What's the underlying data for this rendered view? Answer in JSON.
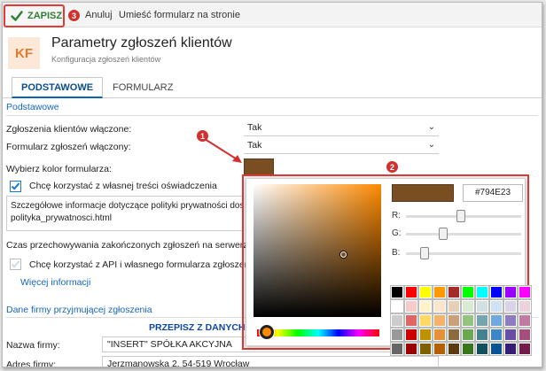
{
  "toolbar": {
    "save_label": "ZAPISZ",
    "cancel_label": "Anuluj",
    "embed_label": "Umieść formularz na stronie"
  },
  "badges": {
    "b1": "1",
    "b2": "2",
    "b3": "3"
  },
  "header": {
    "logo_text": "KF",
    "title": "Parametry zgłoszeń klientów",
    "subtitle": "Konfiguracja zgłoszeń klientów"
  },
  "tabs": [
    {
      "label": "PODSTAWOWE"
    },
    {
      "label": "FORMULARZ"
    }
  ],
  "basic": {
    "section_title": "Podstawowe",
    "requests_enabled_label": "Zgłoszenia klientów włączone:",
    "requests_enabled_value": "Tak",
    "form_enabled_label": "Formularz zgłoszeń włączony:",
    "form_enabled_value": "Tak",
    "color_label": "Wybierz kolor formularza:",
    "own_statement_label": "Chcę korzystać z własnej treści oświadczenia",
    "statement_line1": "Szczegółowe informacje dotyczące polityki prywatności dost",
    "statement_line2": "polityka_prywatnosci.html",
    "retention_label": "Czas przechowywania zakończonych zgłoszeń na serwerze:",
    "api_label": "Chcę korzystać z API i własnego formularza zgłoszeń kli",
    "more_info": "Więcej informacji"
  },
  "company": {
    "section_title": "Dane firmy przyjmującej zgłoszenia",
    "copy_title": "PRZEPISZ Z DANYCH M",
    "name_label": "Nazwa firmy:",
    "name_value": "\"INSERT\" SPÓŁKA AKCYJNA",
    "address_label": "Adres firmy:",
    "address_value": "Jerzmanowska 2, 54-519 Wrocław"
  },
  "picker": {
    "hex_value": "#794E23",
    "selected_color": "#794E23",
    "hue_fraction": 0.08,
    "r_label": "R:",
    "g_label": "G:",
    "b_label": "B:",
    "r_value": 121,
    "g_value": 78,
    "b_value": 35,
    "sv_saturation": 0.71,
    "sv_value": 0.47,
    "palette": [
      "#000000",
      "#ff0000",
      "#ffff00",
      "#ff9900",
      "#a52a2a",
      "#00ff00",
      "#00ffff",
      "#0000ff",
      "#9900ff",
      "#ff00ff",
      "#ffffff",
      "#f4cccc",
      "#fff2cc",
      "#fce5cd",
      "#e6d0b8",
      "#d9ead3",
      "#d0e0e3",
      "#cfe2f3",
      "#d9d2e9",
      "#ead1dc",
      "#cccccc",
      "#e06666",
      "#ffd966",
      "#f6b26b",
      "#c9a27c",
      "#93c47d",
      "#76a5af",
      "#6fa8dc",
      "#8e7cc3",
      "#c27ba0",
      "#999999",
      "#cc0000",
      "#bf9000",
      "#e69138",
      "#8b6b3d",
      "#6aa84f",
      "#45818e",
      "#3d85c6",
      "#674ea7",
      "#a64d79",
      "#666666",
      "#990000",
      "#7f6000",
      "#b45f06",
      "#5c3b12",
      "#38761d",
      "#134f5c",
      "#0b5394",
      "#351c75",
      "#741b47"
    ]
  },
  "colors": {
    "accent": "#1565c0",
    "highlight": "#e53935",
    "save_green": "#2e7d32"
  }
}
